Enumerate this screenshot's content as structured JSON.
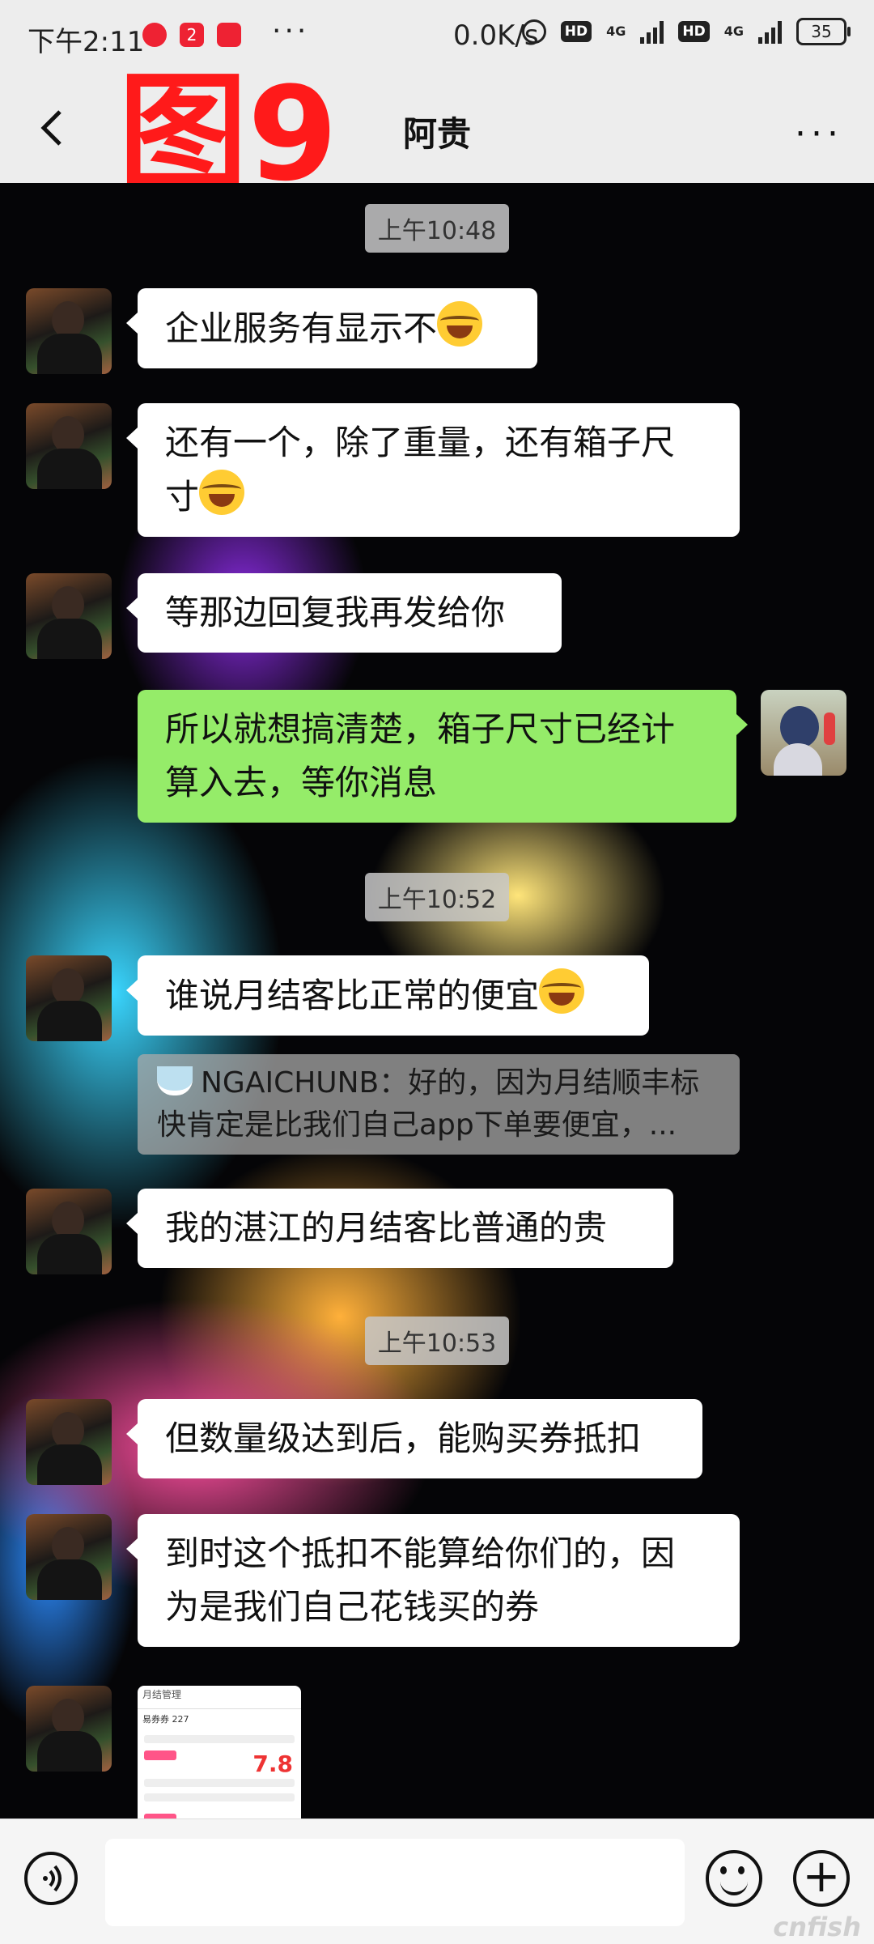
{
  "status_bar": {
    "time": "下午2:11",
    "app_icons": [
      "2"
    ],
    "more": "···",
    "speed": "0.0K/s",
    "hd1": "HD",
    "net1": "4G",
    "hd2": "HD",
    "net2": "4G",
    "battery": "35"
  },
  "header": {
    "watermark_label": "图9",
    "title": "阿贵",
    "more": "···"
  },
  "timestamps": [
    "上午10:48",
    "上午10:52",
    "上午10:53"
  ],
  "messages": [
    {
      "side": "left",
      "text": "企业服务有显示不",
      "emoji": true
    },
    {
      "side": "left",
      "text_line1": "还有一个，除了重量，还有箱子尺",
      "text_line2": "寸",
      "emoji": true
    },
    {
      "side": "left",
      "text": "等那边回复我再发给你"
    },
    {
      "side": "right",
      "text_line1": "所以就想搞清楚，箱子尺寸已经计",
      "text_line2": "算入去，等你消息"
    },
    {
      "side": "left",
      "text": "谁说月结客比正常的便宜",
      "emoji": true
    },
    {
      "side": "left",
      "text": "我的湛江的月结客比普通的贵"
    },
    {
      "side": "left",
      "text": "但数量级达到后，能购买券抵扣"
    },
    {
      "side": "left",
      "text_line1": "到时这个抵扣不能算给你们的，因",
      "text_line2": "为是我们自己花钱买的券"
    }
  ],
  "quote": {
    "line1": "NGAICHUNB：好的，因为月结顺丰标",
    "line2": "快肯定是比我们自己app下单要便宜，..."
  },
  "image_message": {
    "title": "月结管理",
    "count_label": "易券券 227",
    "price": "7.8"
  },
  "input": {
    "placeholder": ""
  },
  "watermark": "cnfish"
}
